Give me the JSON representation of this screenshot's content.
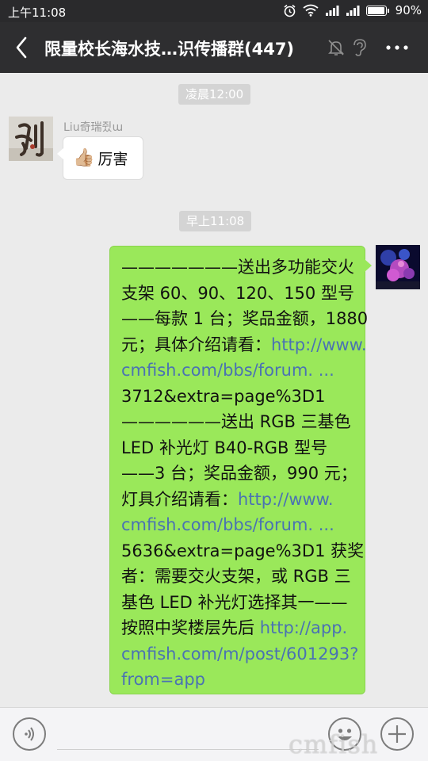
{
  "status_bar": {
    "time": "上午11:08",
    "battery": "90%"
  },
  "header": {
    "title": "限量校长海水技…识传播群(447)"
  },
  "messages": [
    {
      "type": "timestamp",
      "text": "凌晨12:00"
    },
    {
      "type": "incoming",
      "sender": "Liu奇瑞쥤ɯ",
      "text": "厉害",
      "emoji": "👍🏼"
    },
    {
      "type": "timestamp",
      "text": "早上11:08"
    },
    {
      "type": "outgoing",
      "lines": [
        "———————送出多功能交火",
        "支架 60、90、120、150 型号",
        "——每款 1 台；奖品金额，1880",
        "元；具体介绍请看：",
        "cmfish.com/bbs/forum. ...",
        "3712&extra=page%3D1",
        "——————送出 RGB 三基色",
        "LED 补光灯 B40-RGB 型号",
        "——3 台；奖品金额，990 元；",
        "灯具介绍请看：",
        "cmfish.com/bbs/forum. ...",
        "5636&extra=page%3D1 获奖",
        "者：需要交火支架，或 RGB 三",
        "基色 LED 补光灯选择其一——",
        "按照中奖楼层先后",
        "cmfish.com/m/post/601293?",
        "from=app"
      ],
      "links": {
        "l1": "http://www.",
        "l2": "http://www.",
        "l3": "http://app."
      }
    }
  ],
  "watermark": "cmfish",
  "icons": [
    "back-arrow-icon",
    "mute-icon",
    "earpiece-icon",
    "more-icon",
    "voice-icon",
    "emoji-icon",
    "plus-icon"
  ],
  "colors": {
    "outgoing_bubble": "#9ae85a",
    "link": "#4a72b3",
    "title_bar": "#2e2e30"
  }
}
